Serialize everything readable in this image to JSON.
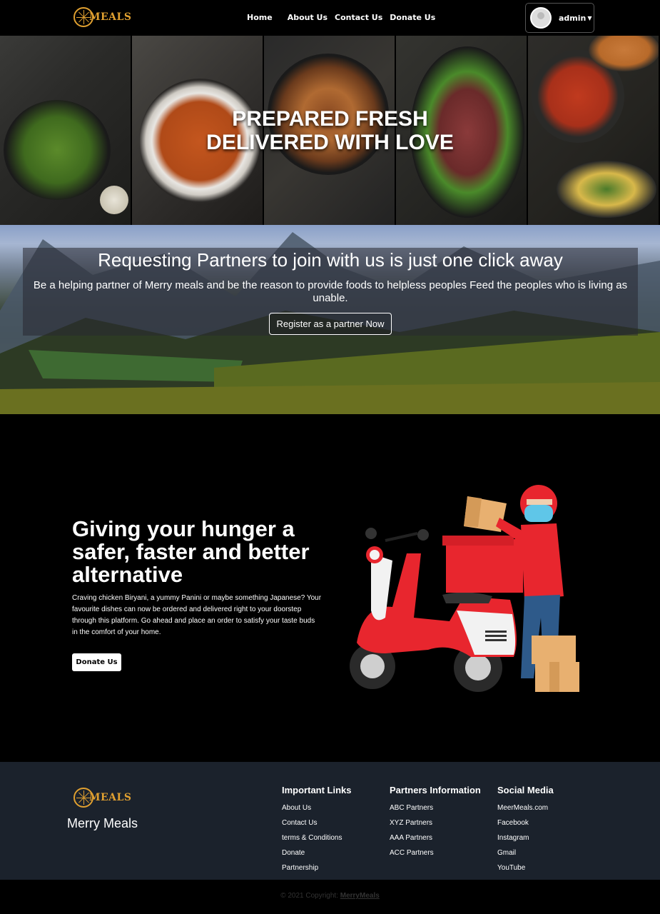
{
  "nav": {
    "logo_text": "MEALS",
    "links": [
      "Home",
      "About Us",
      "Contact Us",
      "Donate Us"
    ],
    "user": "admin"
  },
  "hero": {
    "line1": "PREPARED FRESH",
    "line2": "DELIVERED WITH LOVE"
  },
  "banner": {
    "title": "Requesting Partners to join with us is just one click away",
    "text": "Be a helping partner of Merry meals and be the reason to provide foods to helpless peoples Feed the peoples who is living as unable.",
    "button": "Register as a partner Now"
  },
  "hunger": {
    "title": "Giving your hunger a safer, faster and better alternative",
    "text": "Craving chicken Biryani, a yummy Panini or maybe something Japanese? Your favourite dishes can now be ordered and delivered right to your doorstep through this platform. Go ahead and place an order to satisfy your taste buds in the comfort of your home.",
    "button": "Donate Us"
  },
  "footer": {
    "logo_text": "MEALS",
    "brand": "Merry Meals",
    "columns": [
      {
        "title": "Important Links",
        "items": [
          "About Us",
          "Contact Us",
          "terms & Conditions",
          "Donate",
          "Partnership"
        ]
      },
      {
        "title": "Partners Information",
        "items": [
          "ABC Partners",
          "XYZ Partners",
          "AAA Partners",
          "ACC Partners"
        ]
      },
      {
        "title": "Social Media",
        "items": [
          "MeerMeals.com",
          "Facebook",
          "Instagram",
          "Gmail",
          "YouTube"
        ]
      }
    ],
    "copyright_prefix": "© 2021 Copyright:",
    "copyright_link": "MerryMeals"
  },
  "colors": {
    "logo_gold": "#e0a030",
    "footer_bg": "#1b222c",
    "scooter_red": "#e8262e"
  }
}
